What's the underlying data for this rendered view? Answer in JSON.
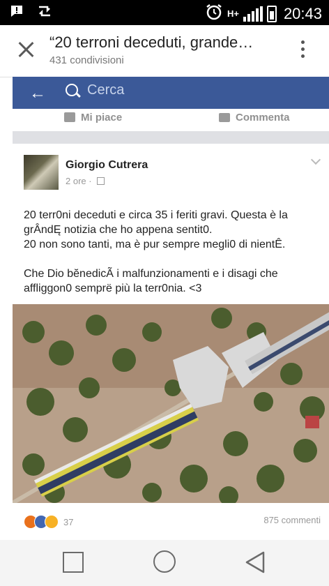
{
  "status_bar": {
    "time": "20:43",
    "network_label": "H+"
  },
  "app_bar": {
    "title": "“20 terroni deceduti, grande…",
    "subtitle": "431 condivisioni"
  },
  "facebook_bar": {
    "search_placeholder": "Cerca",
    "brand_color": "#3b5998"
  },
  "actions": {
    "like_label": "Mi piace",
    "comment_label": "Commenta"
  },
  "post": {
    "author": "Giorgio Cutrera",
    "time": "2 ore",
    "text_lines": [
      "20 terr0ni deceduti e circa 35 i feriti gravi. Questa è la",
      "grÂndĘ notizia che ho appena sentit0.",
      "20 non sono tanti, ma è pur sempre megli0 di nientÊ.",
      "",
      "Che Dio bĕnedicÃ i malfunzionamenti e i disagi che",
      "affliggon0 semprë più la terr0nia. <3"
    ],
    "reactions_count": "37",
    "reaction_icons": [
      "angry-icon",
      "like-icon",
      "haha-icon"
    ],
    "comments_count": "875 commenti"
  },
  "nav_bar": {
    "icons": [
      "recent-apps-icon",
      "home-icon",
      "back-icon"
    ]
  }
}
